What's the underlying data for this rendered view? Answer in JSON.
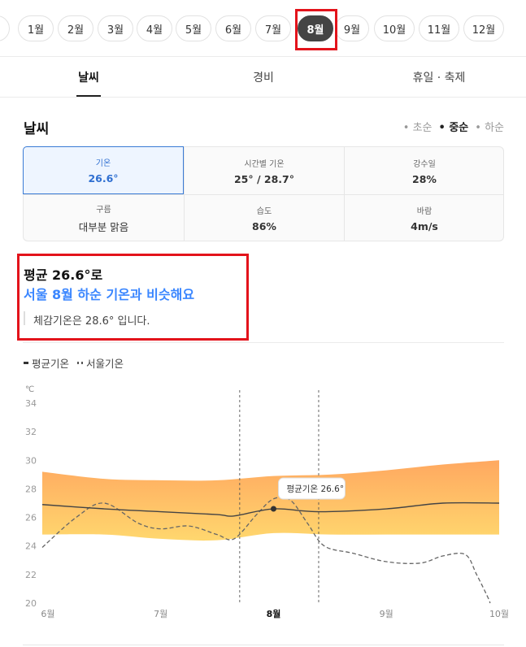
{
  "months": {
    "items": [
      {
        "label": "월",
        "active": false
      },
      {
        "label": "1월",
        "active": false
      },
      {
        "label": "2월",
        "active": false
      },
      {
        "label": "3월",
        "active": false
      },
      {
        "label": "4월",
        "active": false
      },
      {
        "label": "5월",
        "active": false
      },
      {
        "label": "6월",
        "active": false
      },
      {
        "label": "7월",
        "active": false
      },
      {
        "label": "8월",
        "active": true
      },
      {
        "label": "9월",
        "active": false
      },
      {
        "label": "10월",
        "active": false
      },
      {
        "label": "11월",
        "active": false
      },
      {
        "label": "12월",
        "active": false
      }
    ]
  },
  "tabs": [
    {
      "label": "날씨",
      "active": true
    },
    {
      "label": "경비",
      "active": false
    },
    {
      "label": "휴일 · 축제",
      "active": false
    }
  ],
  "weather": {
    "title": "날씨",
    "levels": [
      {
        "label": "• 초순",
        "active": false
      },
      {
        "label": "• 중순",
        "active": true
      },
      {
        "label": "• 하순",
        "active": false
      }
    ],
    "cells": [
      {
        "label": "기온",
        "value": "26.6°"
      },
      {
        "label": "시간별 기온",
        "value": "25° / 28.7°"
      },
      {
        "label": "강수일",
        "value": "28%"
      },
      {
        "label": "구름",
        "value": "대부분 맑음"
      },
      {
        "label": "습도",
        "value": "86%"
      },
      {
        "label": "바람",
        "value": "4m/s"
      }
    ]
  },
  "summary": {
    "line1": "평균 26.6°로",
    "line2": "서울 8월 하순 기온과 비슷해요",
    "line3": "체감기온은 28.6° 입니다."
  },
  "legend": {
    "avg": "평균기온",
    "seoul": "서울기온"
  },
  "colors": {
    "accent": "#3a86ff",
    "highlight": "#e3131b",
    "band_top": "#ffa860",
    "band_bottom": "#ffd76e"
  },
  "chart_data": {
    "type": "line",
    "y_unit": "℃",
    "ylim": [
      20,
      34
    ],
    "y_ticks": [
      "34",
      "32",
      "30",
      "28",
      "26",
      "24",
      "22",
      "20"
    ],
    "x_ticks": [
      {
        "label": "6월",
        "x": 0.5,
        "bold": false
      },
      {
        "label": "7월",
        "x": 1.5,
        "bold": false
      },
      {
        "label": "8월",
        "x": 2.5,
        "bold": true
      },
      {
        "label": "9월",
        "x": 3.5,
        "bold": false
      },
      {
        "label": "10월",
        "x": 4.5,
        "bold": false
      }
    ],
    "xlim": [
      0.45,
      4.5
    ],
    "selected_range": [
      2.2,
      2.9
    ],
    "series": [
      {
        "name": "평균기온",
        "style": "solid",
        "x": [
          0.45,
          1.0,
          1.5,
          2.0,
          2.15,
          2.5,
          2.9,
          3.5,
          4.0,
          4.5
        ],
        "y": [
          26.9,
          26.6,
          26.4,
          26.2,
          26.1,
          26.6,
          26.4,
          26.6,
          27.0,
          27.0
        ]
      },
      {
        "name": "서울기온",
        "style": "dashed",
        "x": [
          0.45,
          0.75,
          1.0,
          1.3,
          1.5,
          1.75,
          2.0,
          2.15,
          2.35,
          2.5,
          2.65,
          2.8,
          2.95,
          3.2,
          3.5,
          3.8,
          4.0,
          4.2,
          4.3,
          4.4,
          4.42
        ],
        "y": [
          23.9,
          26.0,
          27.0,
          25.6,
          25.2,
          25.4,
          24.8,
          24.5,
          26.2,
          27.3,
          27.2,
          25.6,
          24.0,
          23.5,
          22.9,
          22.8,
          23.3,
          23.4,
          22.0,
          20.4,
          20.0
        ]
      }
    ],
    "band_upper": {
      "x": [
        0.45,
        1.0,
        1.5,
        2.0,
        2.5,
        3.0,
        3.5,
        4.0,
        4.5
      ],
      "y": [
        29.2,
        28.7,
        28.6,
        28.6,
        28.9,
        29.0,
        29.3,
        29.7,
        30.0
      ]
    },
    "band_lower": {
      "x": [
        0.45,
        1.0,
        1.5,
        2.0,
        2.5,
        3.0,
        3.5,
        4.0,
        4.5
      ],
      "y": [
        24.8,
        24.8,
        24.5,
        24.4,
        24.9,
        24.8,
        24.8,
        24.8,
        24.8
      ]
    },
    "marker": {
      "x": 2.5,
      "y": 26.6,
      "label": "평균기온 26.6°"
    }
  }
}
